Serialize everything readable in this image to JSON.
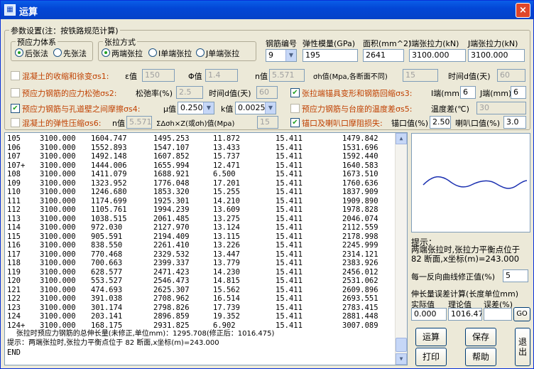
{
  "window": {
    "title": "运算",
    "close": "×"
  },
  "params": {
    "caption": "参数设置(注：按铁路规范计算)",
    "system": {
      "caption": "预应力体系",
      "options": [
        "后张法",
        "先张法"
      ],
      "selected": 0
    },
    "tension": {
      "caption": "张拉方式",
      "options": [
        "两端张拉",
        "I单端张拉",
        "J单端张拉"
      ],
      "selected": 0
    },
    "rebar": {
      "label": "钢筋编号",
      "value": "9"
    },
    "modulus": {
      "label": "弹性模量(GPa)",
      "value": "195"
    },
    "area": {
      "label": "面积(mm^2)",
      "value": "2641"
    },
    "force_i": {
      "label": "I端张拉力(kN)",
      "value": "3100.000"
    },
    "force_j": {
      "label": "J端张拉力(kN)",
      "value": "3100.000"
    },
    "s1": {
      "label": "混凝土的收缩和徐变σs1:",
      "checked": false,
      "eps_label": "ε值",
      "eps": "150",
      "phi_label": "Φ值",
      "phi": "1.4",
      "n_label": "n值",
      "n": "5.571",
      "sh_label": "σh值(Mpa,各断面不同)",
      "sh": "15",
      "t_label": "时间d值(天)",
      "t": "60"
    },
    "s2": {
      "label": "预应力钢筋的应力松弛σs2:",
      "checked": false,
      "relax_label": "松弛率(%)",
      "relax": "2.5",
      "t_label": "时间d值(天)",
      "t": "60"
    },
    "s3": {
      "label": "张拉端锚具变形和钢筋回缩σs3:",
      "checked": true,
      "i_label": "I端(mm)",
      "i": "6",
      "j_label": "J端(mm)",
      "j": "6"
    },
    "s4": {
      "label": "预应力钢筋与孔道壁之间摩擦σs4:",
      "checked": true,
      "mu_label": "μ值",
      "mu": "0.250",
      "k_label": "k值",
      "k": "0.0025"
    },
    "s5": {
      "label": "预应力钢筋与台座的温度差σs5:",
      "checked": false,
      "temp_label": "温度差(℃)",
      "temp": "30"
    },
    "s6": {
      "label": "混凝土的弹性压缩σs6:",
      "checked": false,
      "n_label": "n值",
      "n": "5.571",
      "sum_label": "ΣΔσh×Z(或σh)值(Mpa)",
      "sum": "15"
    },
    "s7": {
      "label": "锚口及喇叭口摩阻损失:",
      "checked": true,
      "anchor_label": "锚口值(%)",
      "anchor": "2.50",
      "horn_label": "喇叭口值(%)",
      "horn": "3.0"
    }
  },
  "output": {
    "rows": [
      [
        "105",
        "3100.000",
        "1604.747",
        "1495.253",
        "11.872",
        "15.411",
        "1479.842"
      ],
      [
        "106",
        "3100.000",
        "1552.893",
        "1547.107",
        "13.433",
        "15.411",
        "1531.696"
      ],
      [
        "107",
        "3100.000",
        "1492.148",
        "1607.852",
        "15.737",
        "15.411",
        "1592.440"
      ],
      [
        "107+",
        "3100.000",
        "1444.006",
        "1655.994",
        "12.471",
        "15.411",
        "1640.583"
      ],
      [
        "108",
        "3100.000",
        "1411.079",
        "1688.921",
        "6.500",
        "15.411",
        "1673.510"
      ],
      [
        "109",
        "3100.000",
        "1323.952",
        "1776.048",
        "17.201",
        "15.411",
        "1760.636"
      ],
      [
        "110",
        "3100.000",
        "1246.680",
        "1853.320",
        "15.255",
        "15.411",
        "1837.909"
      ],
      [
        "111",
        "3100.000",
        "1174.699",
        "1925.301",
        "14.210",
        "15.411",
        "1909.890"
      ],
      [
        "112",
        "3100.000",
        "1105.761",
        "1994.239",
        "13.609",
        "15.411",
        "1978.828"
      ],
      [
        "113",
        "3100.000",
        "1038.515",
        "2061.485",
        "13.275",
        "15.411",
        "2046.074"
      ],
      [
        "114",
        "3100.000",
        "972.030",
        "2127.970",
        "13.124",
        "15.411",
        "2112.559"
      ],
      [
        "115",
        "3100.000",
        "905.591",
        "2194.409",
        "13.115",
        "15.411",
        "2178.998"
      ],
      [
        "116",
        "3100.000",
        "838.550",
        "2261.410",
        "13.226",
        "15.411",
        "2245.999"
      ],
      [
        "117",
        "3100.000",
        "770.468",
        "2329.532",
        "13.447",
        "15.411",
        "2314.121"
      ],
      [
        "118",
        "3100.000",
        "700.663",
        "2399.337",
        "13.779",
        "15.411",
        "2383.926"
      ],
      [
        "119",
        "3100.000",
        "628.577",
        "2471.423",
        "14.230",
        "15.411",
        "2456.012"
      ],
      [
        "120",
        "3100.000",
        "553.527",
        "2546.473",
        "14.815",
        "15.411",
        "2531.062"
      ],
      [
        "121",
        "3100.000",
        "474.693",
        "2625.307",
        "15.562",
        "15.411",
        "2609.896"
      ],
      [
        "122",
        "3100.000",
        "391.038",
        "2708.962",
        "16.514",
        "15.411",
        "2693.551"
      ],
      [
        "123",
        "3100.000",
        "301.174",
        "2798.826",
        "17.739",
        "15.411",
        "2783.415"
      ],
      [
        "124",
        "3100.000",
        "203.141",
        "2896.859",
        "19.352",
        "15.411",
        "2881.448"
      ],
      [
        "124+",
        "3100.000",
        "168.175",
        "2931.825",
        "6.902",
        "15.411",
        "3007.089"
      ]
    ],
    "line1": "    张拉时预应力钢筋的总伸长量(未修正,单位mm)：1295.708(修正后：1016.475)",
    "line2": "提示：两端张拉时,张拉力平衡点位于 82 断面,x坐标(m)=243.000",
    "line3": "END"
  },
  "hint": {
    "title": "提示：",
    "text": "两端张拉时,张拉力平衡点位于 82 断面,x坐标(m)=243.000"
  },
  "curve": {
    "label": "每一反向曲线修正值(%)",
    "value": "5"
  },
  "elong": {
    "title": "伸长量误差计算(长度单位mm)",
    "actual_label": "实际值",
    "actual": "0.000",
    "theory_label": "理论值",
    "theory": "1016.47",
    "err_label": "误差(%)",
    "err": "",
    "go": "GO"
  },
  "buttons": {
    "run": "运算",
    "save": "保存",
    "exit": "退出",
    "print": "打印",
    "help": "帮助"
  },
  "colors": {
    "title_bar": "#0347d6",
    "curve_line": "#1a2fb0"
  }
}
